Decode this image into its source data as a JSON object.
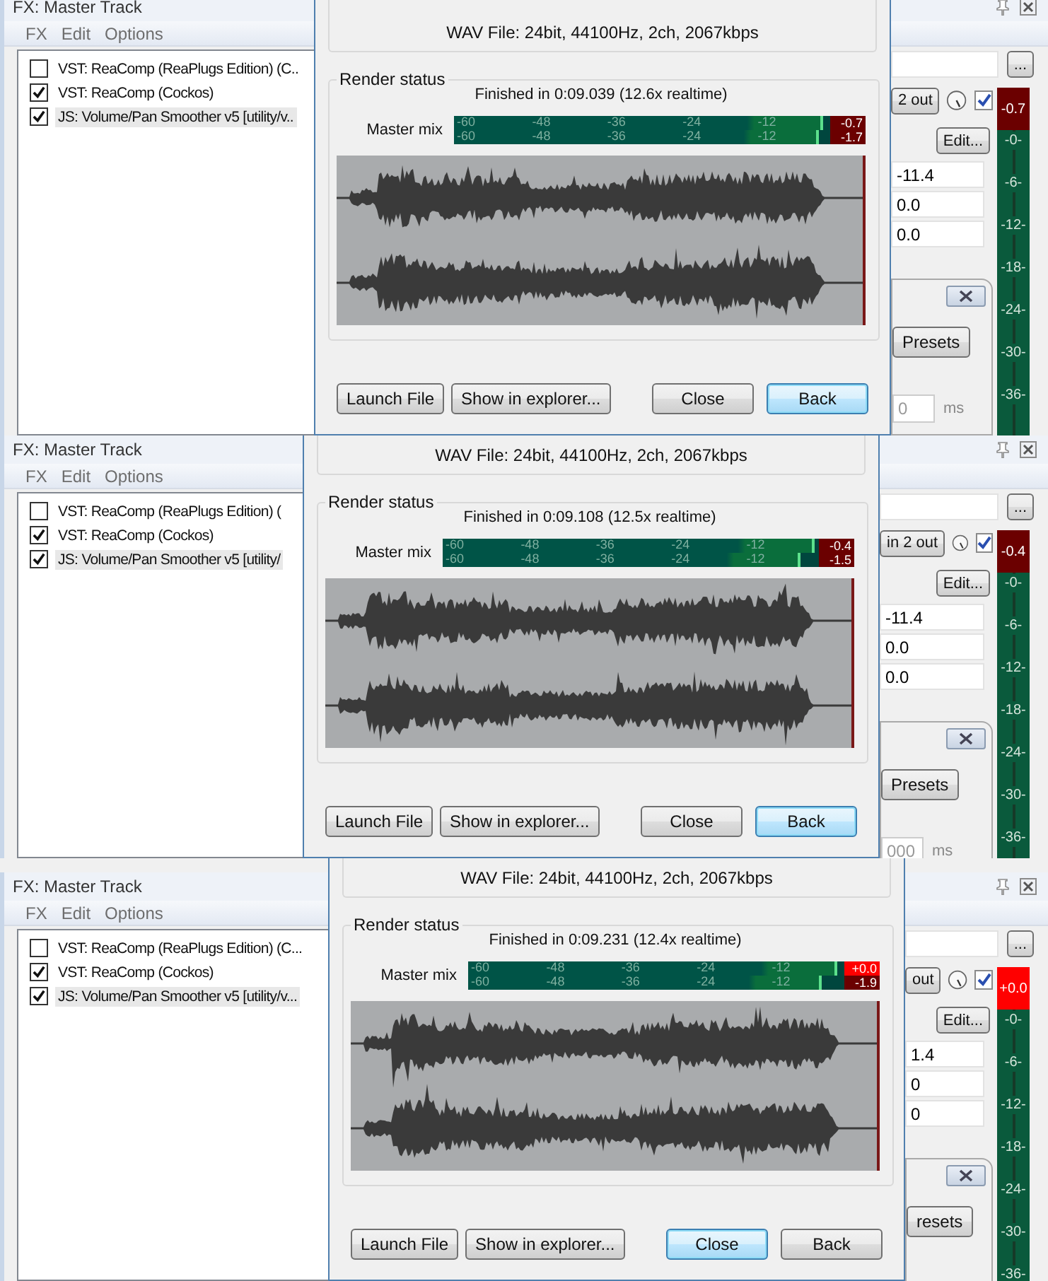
{
  "panels": [
    {
      "fx_window": {
        "title": "FX: Master Track",
        "menu": [
          "FX",
          "Edit",
          "Options"
        ],
        "items": [
          {
            "label": "VST: ReaComp (ReaPlugs Edition) (C..",
            "checked": false,
            "selected": false
          },
          {
            "label": "VST: ReaComp (Cockos)",
            "checked": true,
            "selected": false
          },
          {
            "label": "JS: Volume/Pan Smoother v5 [utility/v..",
            "checked": true,
            "selected": true
          }
        ]
      },
      "render_dialog": {
        "file_info": "WAV File: 24bit, 44100Hz, 2ch, 2067kbps",
        "group_title": "Render status",
        "status": "Finished in 0:09.039 (12.6x realtime)",
        "meter_label": "Master mix",
        "meter_channels": [
          {
            "scale": [
              "-60",
              "-48",
              "-36",
              "-24",
              "-12"
            ],
            "level": 0.98,
            "peak": "-0.7",
            "clipped": false
          },
          {
            "scale": [
              "-60",
              "-48",
              "-36",
              "-24",
              "-12"
            ],
            "level": 0.97,
            "peak": "-1.7",
            "clipped": false
          }
        ],
        "buttons": [
          {
            "label": "Launch File",
            "default": false
          },
          {
            "label": "Show in explorer...",
            "default": false
          },
          {
            "label": "Close",
            "default": false
          },
          {
            "label": "Back",
            "default": true
          }
        ]
      },
      "plugin_panel": {
        "browse_button": "...",
        "io_button": "2 out",
        "enabled": true,
        "edit_button": "Edit...",
        "fields": [
          "-11.4",
          "0.0",
          "0.0"
        ],
        "presets_button": "Presets",
        "time_field": "0",
        "time_unit": "ms",
        "meter": {
          "readout": "-0.7",
          "clipped": false,
          "scale": [
            "-0-",
            "-6-",
            "-12-",
            "-18-",
            "-24-",
            "-30-",
            "-36-"
          ]
        }
      }
    },
    {
      "fx_window": {
        "title": "FX: Master Track",
        "menu": [
          "FX",
          "Edit",
          "Options"
        ],
        "items": [
          {
            "label": "VST: ReaComp (ReaPlugs Edition) (",
            "checked": false,
            "selected": false
          },
          {
            "label": "VST: ReaComp (Cockos)",
            "checked": true,
            "selected": false
          },
          {
            "label": "JS: Volume/Pan Smoother v5 [utility/",
            "checked": true,
            "selected": true
          }
        ]
      },
      "render_dialog": {
        "file_info": "WAV File: 24bit, 44100Hz, 2ch, 2067kbps",
        "group_title": "Render status",
        "status": "Finished in 0:09.108 (12.5x realtime)",
        "meter_label": "Master mix",
        "meter_channels": [
          {
            "scale": [
              "-60",
              "-48",
              "-36",
              "-24",
              "-12"
            ],
            "level": 0.99,
            "peak": "-0.4",
            "clipped": false
          },
          {
            "scale": [
              "-60",
              "-48",
              "-36",
              "-24",
              "-12"
            ],
            "level": 0.95,
            "peak": "-1.5",
            "clipped": false
          }
        ],
        "buttons": [
          {
            "label": "Launch File",
            "default": false
          },
          {
            "label": "Show in explorer...",
            "default": false
          },
          {
            "label": "Close",
            "default": false
          },
          {
            "label": "Back",
            "default": true
          }
        ]
      },
      "plugin_panel": {
        "browse_button": "...",
        "io_button": "in 2 out",
        "enabled": true,
        "edit_button": "Edit...",
        "fields": [
          "-11.4",
          "0.0",
          "0.0"
        ],
        "presets_button": "Presets",
        "time_field": "000",
        "time_unit": "ms",
        "meter": {
          "readout": "-0.4",
          "clipped": false,
          "scale": [
            "-0-",
            "-6-",
            "-12-",
            "-18-",
            "-24-",
            "-30-",
            "-36-"
          ]
        }
      }
    },
    {
      "fx_window": {
        "title": "FX: Master Track",
        "menu": [
          "FX",
          "Edit",
          "Options"
        ],
        "items": [
          {
            "label": "VST: ReaComp (ReaPlugs Edition) (C...",
            "checked": false,
            "selected": false
          },
          {
            "label": "VST: ReaComp (Cockos)",
            "checked": true,
            "selected": false
          },
          {
            "label": "JS: Volume/Pan Smoother v5 [utility/v...",
            "checked": true,
            "selected": true
          }
        ]
      },
      "render_dialog": {
        "file_info": "WAV File: 24bit, 44100Hz, 2ch, 2067kbps",
        "group_title": "Render status",
        "status": "Finished in 0:09.231 (12.4x realtime)",
        "meter_label": "Master mix",
        "meter_channels": [
          {
            "scale": [
              "-60",
              "-48",
              "-36",
              "-24",
              "-12"
            ],
            "level": 0.98,
            "peak": "+0.0",
            "clipped": true
          },
          {
            "scale": [
              "-60",
              "-48",
              "-36",
              "-24",
              "-12"
            ],
            "level": 0.94,
            "peak": "-1.9",
            "clipped": false
          }
        ],
        "buttons": [
          {
            "label": "Launch File",
            "default": false
          },
          {
            "label": "Show in explorer...",
            "default": false
          },
          {
            "label": "Close",
            "default": true
          },
          {
            "label": "Back",
            "default": false
          }
        ]
      },
      "plugin_panel": {
        "browse_button": "...",
        "io_button": "out",
        "enabled": true,
        "edit_button": "Edit...",
        "fields": [
          "1.4",
          "0",
          "0"
        ],
        "presets_button": "resets",
        "meter": {
          "readout": "+0.0",
          "clipped": true,
          "scale": [
            "-0-",
            "-6-",
            "-12-",
            "-18-",
            "-24-",
            "-30-",
            "-36-"
          ]
        }
      }
    }
  ]
}
